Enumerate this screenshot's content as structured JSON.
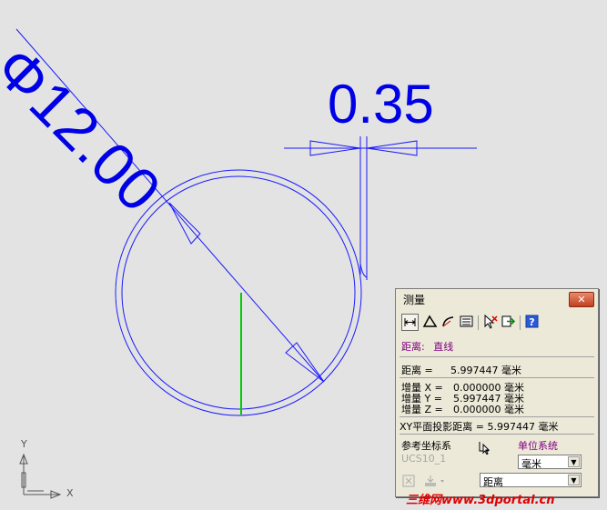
{
  "drawing": {
    "diameter_dim": "Φ12.00",
    "gap_dim": "0.35",
    "ucs_y": "Y",
    "ucs_x": "X"
  },
  "colors": {
    "dimension": "#0000e6",
    "measure_line": "#00cc00",
    "background": "#e3e3e3"
  },
  "panel": {
    "title": "测量",
    "close": "✕",
    "mode_label": "距离:",
    "mode_value": "直线",
    "distance_label": "距离 =",
    "distance_value": "5.997447 毫米",
    "deltas": [
      {
        "label": "增量 X =",
        "value": "0.000000 毫米"
      },
      {
        "label": "增量 Y =",
        "value": "5.997447 毫米"
      },
      {
        "label": "增量 Z =",
        "value": "0.000000 毫米"
      }
    ],
    "xy_projection": "XY平面投影距离 = 5.997447 毫米",
    "ref_coord_label": "参考坐标系",
    "ref_coord_value": "UCS10_1",
    "unit_system_label": "单位系统",
    "unit_select": "毫米",
    "measure_select": "距离"
  },
  "watermark": "三维网www.3dportal.cn"
}
